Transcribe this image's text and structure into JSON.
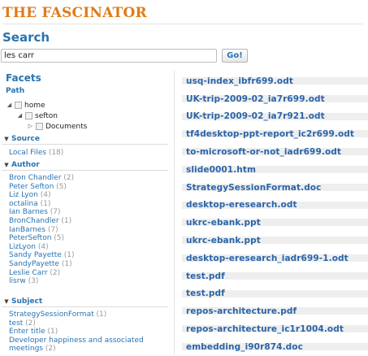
{
  "app": {
    "title": "The Fascinator"
  },
  "search": {
    "heading": "Search",
    "query": "les carr",
    "go_label": "Go!"
  },
  "facets": {
    "heading": "Facets",
    "path": {
      "label": "Path",
      "tree": [
        {
          "label": "home",
          "toggle": "◢",
          "depth": 0
        },
        {
          "label": "sefton",
          "toggle": "◢",
          "depth": 1
        },
        {
          "label": "Documents",
          "toggle": "▷",
          "depth": 2
        }
      ]
    },
    "source": {
      "label": "Source",
      "items": [
        {
          "name": "Local Files",
          "count": "(18)"
        }
      ]
    },
    "author": {
      "label": "Author",
      "items": [
        {
          "name": "Bron Chandler",
          "count": "(2)"
        },
        {
          "name": "Peter Sefton",
          "count": "(5)"
        },
        {
          "name": "Liz Lyon",
          "count": "(4)"
        },
        {
          "name": "octalina",
          "count": "(1)"
        },
        {
          "name": "Ian Barnes",
          "count": "(7)"
        },
        {
          "name": "BronChandler",
          "count": "(1)"
        },
        {
          "name": "IanBarnes",
          "count": "(7)"
        },
        {
          "name": "PeterSefton",
          "count": "(5)"
        },
        {
          "name": "LizLyon",
          "count": "(4)"
        },
        {
          "name": "Sandy Payette",
          "count": "(1)"
        },
        {
          "name": "SandyPayette",
          "count": "(1)"
        },
        {
          "name": "Leslie Carr",
          "count": "(2)"
        },
        {
          "name": "lisrw",
          "count": "(3)"
        }
      ]
    },
    "subject": {
      "label": "Subject",
      "items": [
        {
          "name": "StrategySessionFormat",
          "count": "(1)"
        },
        {
          "name": "test",
          "count": "(2)"
        },
        {
          "name": "Enter title",
          "count": "(1)"
        },
        {
          "name": "Developer happiness and associated meetings",
          "count": "(2)"
        }
      ]
    }
  },
  "results": [
    "usq-index_ibfr699.odt",
    "UK-trip-2009-02_ia7r699.odt",
    "UK-trip-2009-02_ia7r921.odt",
    "tf4desktop-ppt-report_ic2r699.odt",
    "to-microsoft-or-not_iadr699.odt",
    "slide0001.htm",
    "StrategySessionFormat.doc",
    "desktop-eresearch.odt",
    "ukrc-ebank.ppt",
    "ukrc-ebank.ppt",
    "desktop-eresearch_iadr699-1.odt",
    "test.pdf",
    "test.pdf",
    "repos-architecture.pdf",
    "repos-architecture_ic1r1004.odt",
    "embedding_i90r874.doc"
  ],
  "colors": {
    "brand": "#e17a15",
    "accent": "#2a73b0",
    "link": "#2a64a8",
    "count": "#999999"
  },
  "icons": {
    "expanded": "triangle-down-icon",
    "collapsed": "triangle-right-icon",
    "folder": "folder-icon"
  }
}
